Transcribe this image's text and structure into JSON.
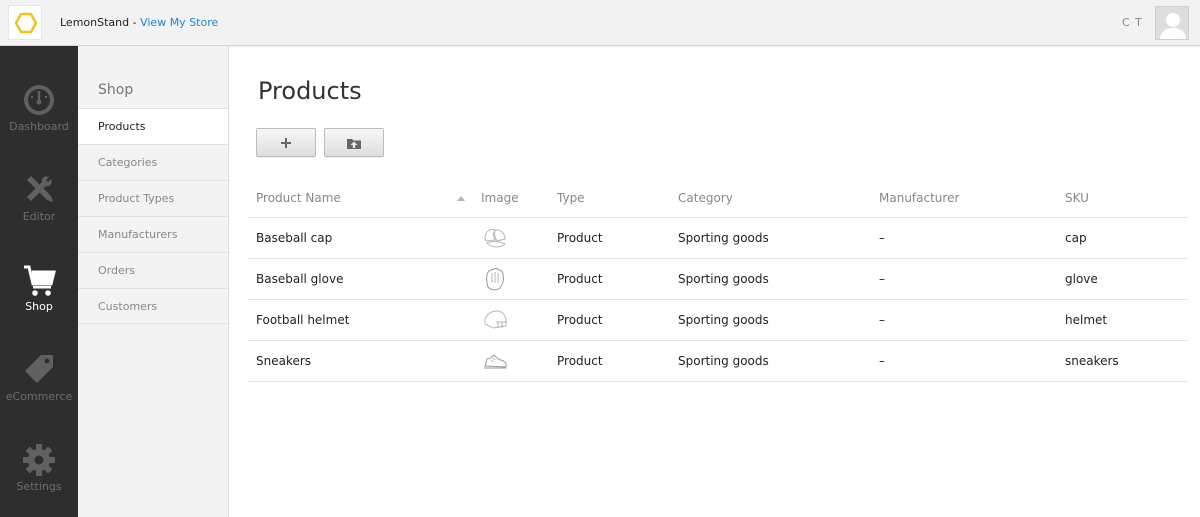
{
  "topbar": {
    "app_name": "LemonStand",
    "separator": " - ",
    "view_store_link": "View My Store",
    "user_initials": "C T"
  },
  "mainnav": {
    "items": [
      {
        "label": "Dashboard",
        "icon": "gauge-icon"
      },
      {
        "label": "Editor",
        "icon": "tools-icon"
      },
      {
        "label": "Shop",
        "icon": "cart-icon",
        "active": true
      },
      {
        "label": "eCommerce",
        "icon": "tag-icon"
      },
      {
        "label": "Settings",
        "icon": "gear-icon"
      }
    ]
  },
  "subnav": {
    "title": "Shop",
    "items": [
      {
        "label": "Products",
        "active": true
      },
      {
        "label": "Categories"
      },
      {
        "label": "Product Types"
      },
      {
        "label": "Manufacturers"
      },
      {
        "label": "Orders"
      },
      {
        "label": "Customers"
      }
    ]
  },
  "page": {
    "title": "Products",
    "add_button_icon": "plus-icon",
    "import_button_icon": "folder-upload-icon"
  },
  "table": {
    "columns": [
      "Product Name",
      "Image",
      "Type",
      "Category",
      "Manufacturer",
      "SKU"
    ],
    "rows": [
      {
        "name": "Baseball cap",
        "image": "cap-icon",
        "type": "Product",
        "category": "Sporting goods",
        "manufacturer": "–",
        "sku": "cap"
      },
      {
        "name": "Baseball glove",
        "image": "glove-icon",
        "type": "Product",
        "category": "Sporting goods",
        "manufacturer": "–",
        "sku": "glove"
      },
      {
        "name": "Football helmet",
        "image": "helmet-icon",
        "type": "Product",
        "category": "Sporting goods",
        "manufacturer": "–",
        "sku": "helmet"
      },
      {
        "name": "Sneakers",
        "image": "sneaker-icon",
        "type": "Product",
        "category": "Sporting goods",
        "manufacturer": "–",
        "sku": "sneakers"
      }
    ]
  },
  "colors": {
    "accent_link": "#1f86c9",
    "logo": "#f2c21b",
    "nav_bg": "#2e2e2e"
  }
}
